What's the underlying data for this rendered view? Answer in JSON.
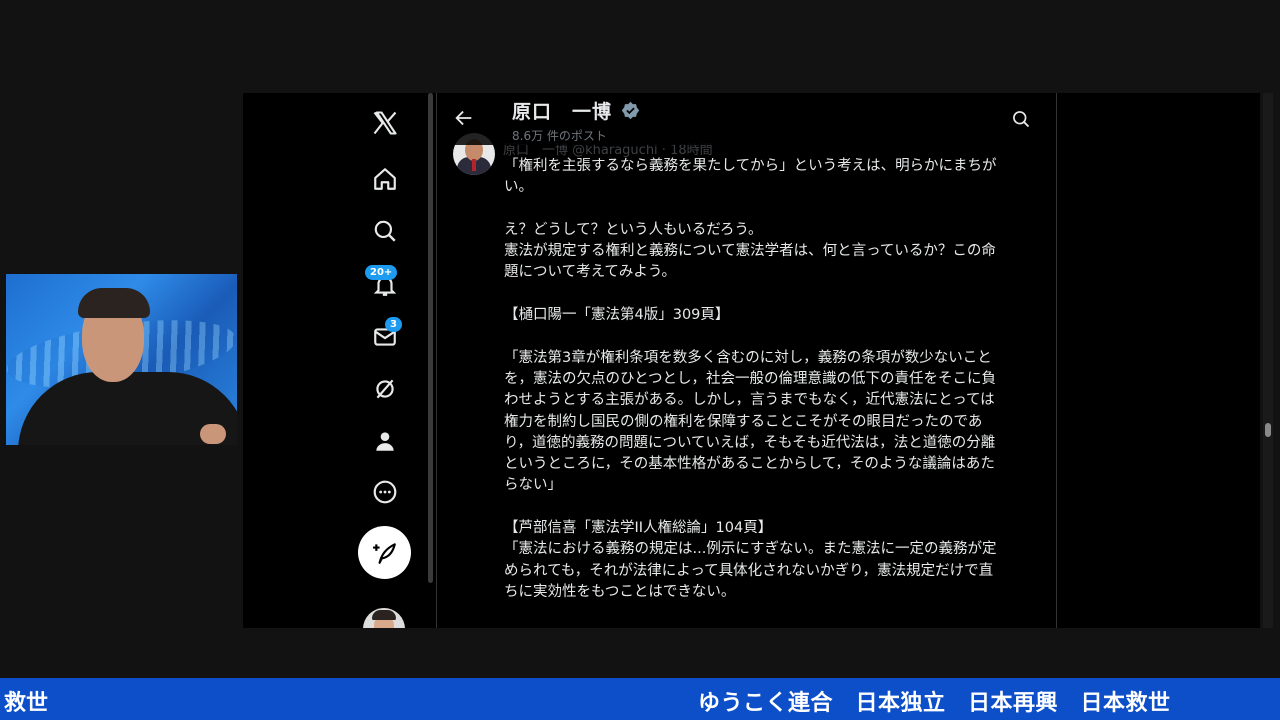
{
  "profile": {
    "name": "原口　一博",
    "post_count": "8.6万 件のポスト",
    "handle_line": "原口　一博 @kharaguchi · 18時間"
  },
  "nav": {
    "notifications_badge": "20+",
    "messages_badge": "3"
  },
  "tweet": {
    "lines": [
      "「権利を主張するなら義務を果たしてから」という考えは、明らかにまちが",
      "い。",
      "",
      "え？どうして？という人もいるだろう。",
      "憲法が規定する権利と義務について憲法学者は、何と言っているか？この命",
      "題について考えてみよう。",
      "",
      "【樋口陽一「憲法第4版」309頁】",
      "",
      "「憲法第3章が権利条項を数多く含むのに対し，義務の条項が数少ないこと",
      "を，憲法の欠点のひとつとし，社会一般の倫理意識の低下の責任をそこに負",
      "わせようとする主張がある。しかし，言うまでもなく，近代憲法にとっては",
      "権力を制約し国民の側の権利を保障することこそがその眼目だったのであ",
      "り，道徳的義務の問題についていえば，そもそも近代法は，法と道徳の分離",
      "というところに，その基本性格があることからして，そのような議論はあた",
      "らない」",
      "",
      "【芦部信喜「憲法学II人権総論」104頁】",
      "「憲法における義務の規定は...例示にすぎない。また憲法に一定の義務が定",
      "められても，それが法律によって具体化されないかぎり，憲法規定だけで直",
      "ちに実効性をもつことはできない。"
    ]
  },
  "ticker": {
    "left": "救世",
    "right": "ゆうこく連合　日本独立　日本再興　日本救世"
  }
}
